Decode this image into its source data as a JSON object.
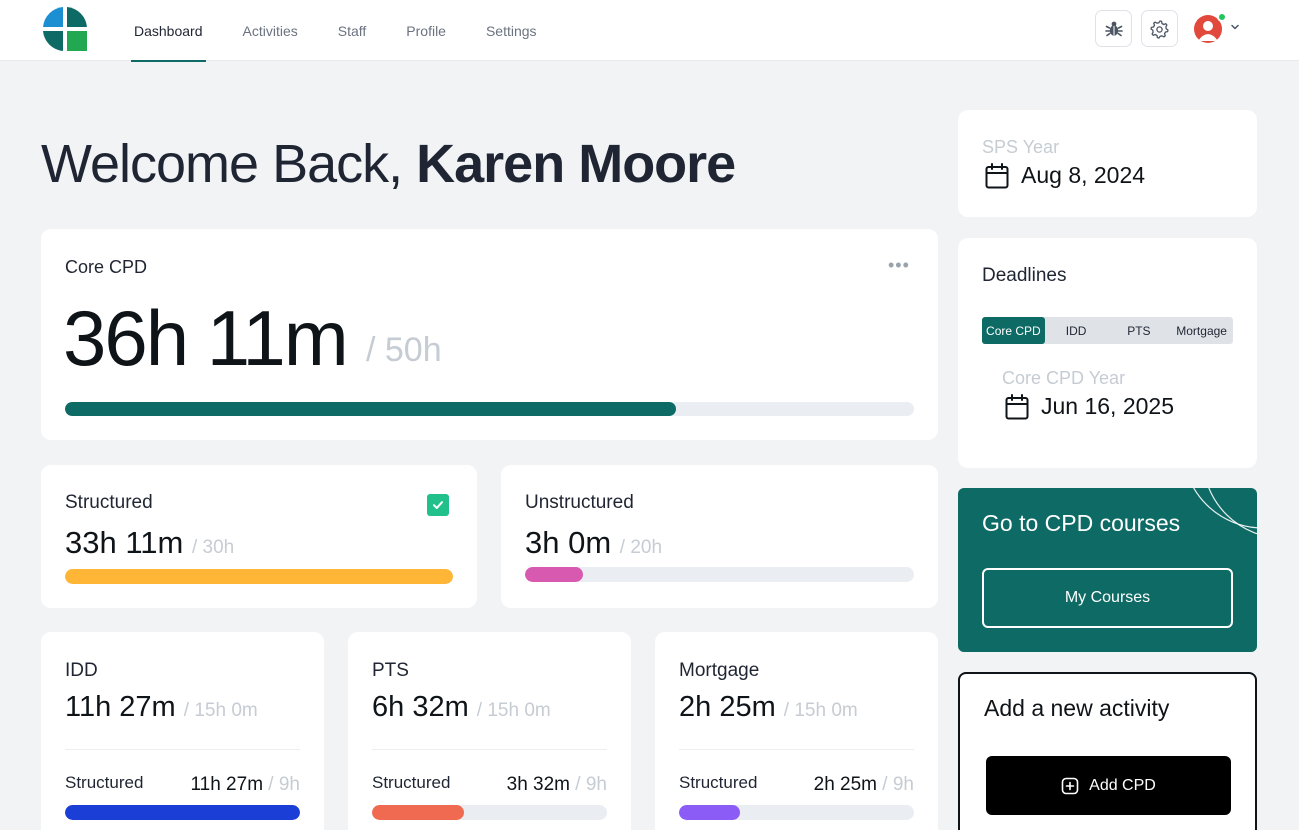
{
  "nav": {
    "items": [
      {
        "label": "Dashboard",
        "active": true
      },
      {
        "label": "Activities",
        "active": false
      },
      {
        "label": "Staff",
        "active": false
      },
      {
        "label": "Profile",
        "active": false
      },
      {
        "label": "Settings",
        "active": false
      }
    ],
    "icons": [
      "bug-icon",
      "gear-icon",
      "avatar",
      "chevron-down-icon"
    ]
  },
  "welcome": {
    "greeting": "Welcome Back, ",
    "name": "Karen Moore"
  },
  "core": {
    "title": "Core CPD",
    "value": "36h 11m",
    "total": "/ 50h",
    "progress": 0.72
  },
  "structured": {
    "title": "Structured",
    "value": "33h 11m",
    "total": "/ 30h",
    "progress": 1.0,
    "completed": true
  },
  "unstructured": {
    "title": "Unstructured",
    "value": "3h 0m",
    "total": "/ 20h",
    "progress": 0.15
  },
  "categories": [
    {
      "title": "IDD",
      "value": "11h 27m",
      "total": "/ 15h 0m",
      "sub_label": "Structured",
      "sub_value": "11h 27m",
      "sub_total": "/ 9h",
      "progress": 1.0
    },
    {
      "title": "PTS",
      "value": "6h 32m",
      "total": "/ 15h 0m",
      "sub_label": "Structured",
      "sub_value": "3h 32m",
      "sub_total": "/ 9h",
      "progress": 0.39
    },
    {
      "title": "Mortgage",
      "value": "2h 25m",
      "total": "/ 15h 0m",
      "sub_label": "Structured",
      "sub_value": "2h 25m",
      "sub_total": "/ 9h",
      "progress": 0.26
    }
  ],
  "sps": {
    "label": "SPS Year",
    "date": "Aug 8, 2024"
  },
  "deadlines": {
    "title": "Deadlines",
    "tabs": [
      "Core CPD",
      "IDD",
      "PTS",
      "Mortgage"
    ],
    "active_tab": "Core CPD",
    "year_label": "Core CPD Year",
    "date": "Jun 16, 2025"
  },
  "promo": {
    "title": "Go to CPD courses",
    "button": "My Courses"
  },
  "add_activity": {
    "title": "Add a new activity",
    "button": "Add CPD"
  },
  "colors": {
    "brand": "#0e6a64",
    "structured_bar": "#ffb636",
    "unstructured_bar": "#d85ab0",
    "idd_bar": "#1b3fd6",
    "pts_bar": "#f06a52",
    "mortgage_bar": "#8b5cf6",
    "check": "#22c08a"
  }
}
